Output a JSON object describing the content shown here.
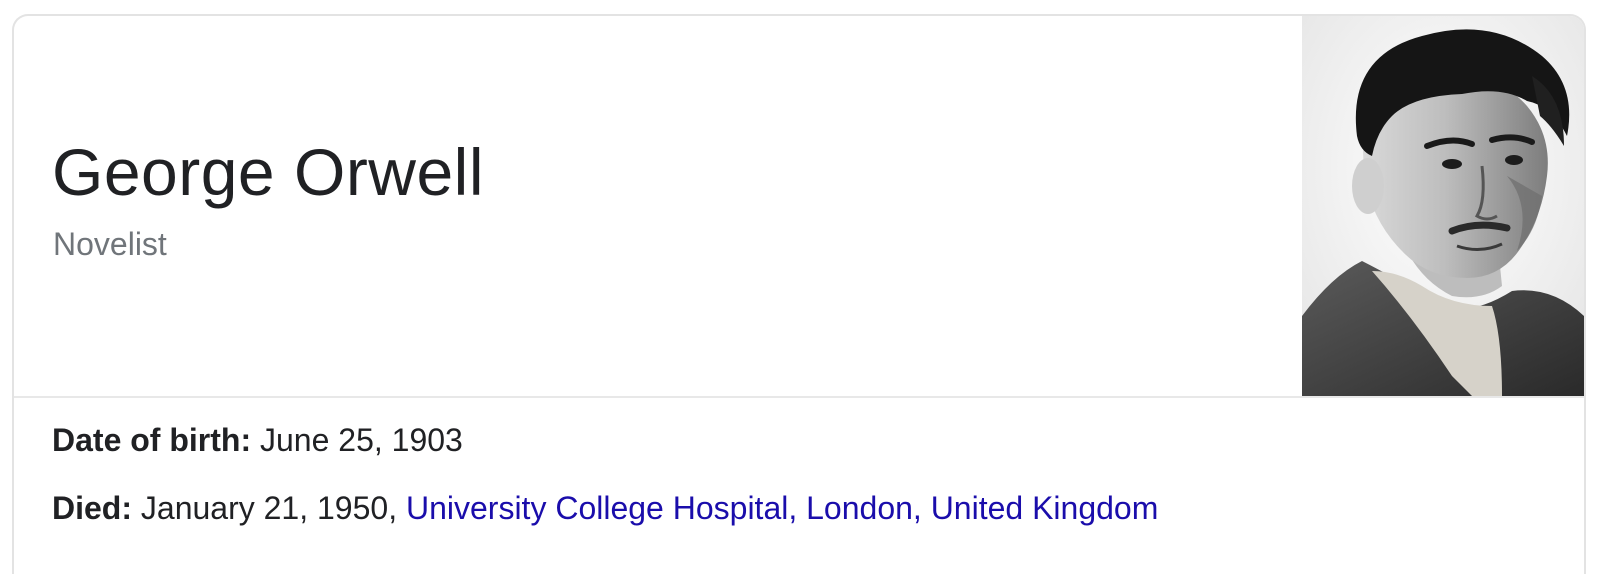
{
  "entity": {
    "name": "George Orwell",
    "description": "Novelist"
  },
  "image": {
    "alt": "George Orwell portrait photo"
  },
  "facts": {
    "birth": {
      "label": "Date of birth:",
      "value": "June 25, 1903"
    },
    "died": {
      "label": "Died:",
      "value": "January 21, 1950, ",
      "place_link": "University College Hospital, London, United Kingdom"
    }
  },
  "colors": {
    "link": "#1a0dab",
    "text": "#202124",
    "secondary": "#70757a",
    "border": "#e3e3e3"
  }
}
